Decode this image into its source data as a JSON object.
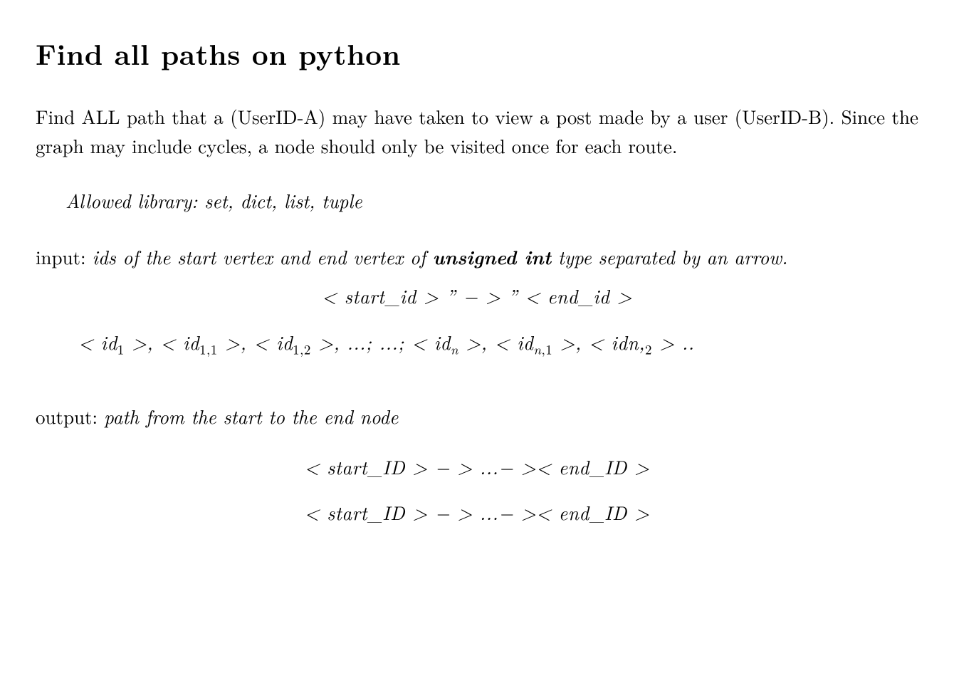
{
  "title": "Find all paths on python",
  "paragraph": "Find ALL path that a (UserID-A) may have taken to view a post made by a user (UserID-B). Since the graph may include cycles, a node should only be visited once for each route.",
  "allowed_library": "Allowed library: set, dict, list, tuple",
  "input": {
    "label": "input: ",
    "desc_pre": "ids of the start vertex and end vertex of ",
    "bold": "unsigned int",
    "desc_post": " type separated by an arrow."
  },
  "math_line1_parts": {
    "lt1": "<",
    "start": " start",
    "us1": "_",
    "id1": "id ",
    "gt1": "> ",
    "quote1": "” ",
    "arrow": "− > ",
    "quote2": "” ",
    "lt2": "< ",
    "end": "end",
    "us2": "_",
    "id2": "id ",
    "gt2": ">"
  },
  "output": {
    "label": "output: ",
    "desc": "path from the start to the end node"
  }
}
